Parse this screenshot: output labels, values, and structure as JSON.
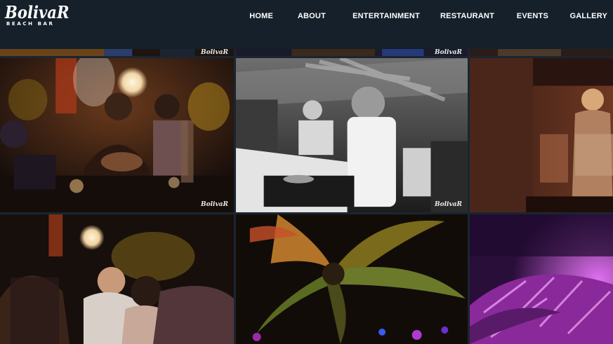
{
  "brand": {
    "name": "BolivaR",
    "tagline": "BEACH BAR"
  },
  "nav": {
    "items": [
      {
        "label": "HOME"
      },
      {
        "label": "ABOUT"
      },
      {
        "label": "ENTERTAINMENT"
      },
      {
        "label": "RESTAURANT"
      },
      {
        "label": "EVENTS"
      },
      {
        "label": "GALLERY"
      }
    ]
  },
  "gallery": {
    "watermark": "BolivaR",
    "photos": [
      {
        "name": "photo-top-strip-left"
      },
      {
        "name": "photo-top-strip-middle"
      },
      {
        "name": "photo-top-strip-right"
      },
      {
        "name": "photo-woman-phone-bar"
      },
      {
        "name": "photo-dj-black-white"
      },
      {
        "name": "photo-woman-dark-room"
      },
      {
        "name": "photo-crowd-lanterns"
      },
      {
        "name": "photo-palm-tree-night"
      },
      {
        "name": "photo-purple-thatch"
      }
    ]
  },
  "colors": {
    "header_bg": "#15202b",
    "nav_text": "#ffffff",
    "gallery_gap": "#1b2530"
  }
}
